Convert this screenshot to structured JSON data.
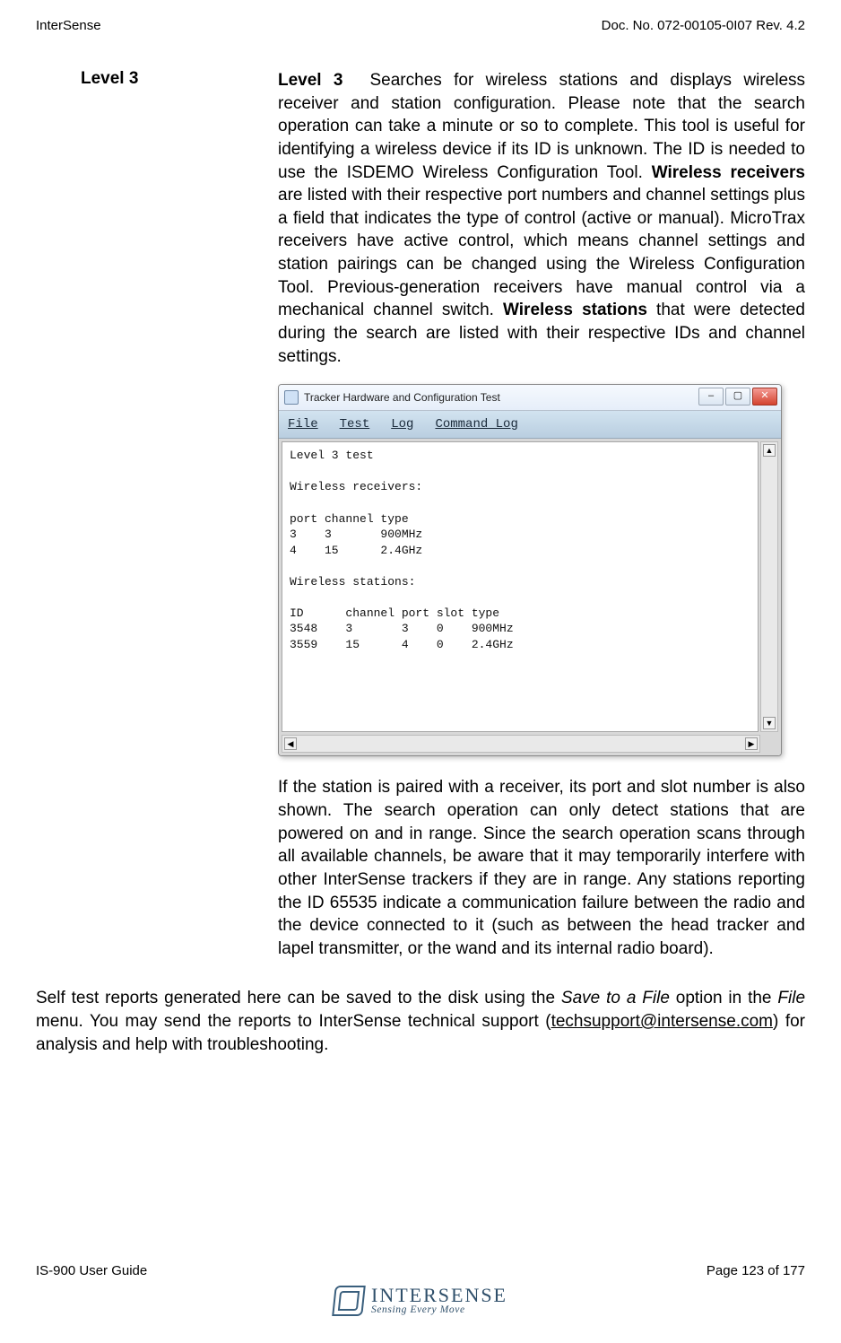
{
  "header": {
    "left": "InterSense",
    "right": "Doc. No. 072-00105-0I07 Rev. 4.2"
  },
  "section": {
    "label": "Level 3",
    "lead": "Level 3",
    "para1a": "Searches for wireless stations and displays wireless receiver  and  station configuration. Please  note  that the search operation can take a minute or so to complete. This tool is useful for identifying a wireless device if its ID is unknown. The ID is needed to use the ISDEMO Wireless Configuration Tool. ",
    "bold1": "Wireless receivers",
    "para1b": " are listed with their respective port numbers and channel settings plus a field that indicates the type of control (active or manual). MicroTrax receivers have active control, which means channel settings and station pairings can be changed using the Wireless Configuration Tool. Previous-generation receivers have manual control via a mechanical channel switch. ",
    "bold2": "Wireless stations",
    "para1c": " that were detected during the search are listed with their respective IDs and channel settings.",
    "para2": " If the station is paired with a receiver, its port and slot number is also shown. The search operation can only detect stations that are powered on and in range. Since the search operation scans through all available channels, be aware that it may temporarily interfere with other InterSense trackers if they are in range.  Any stations reporting the ID 65535 indicate a communication failure between the radio and the device connected to it (such as between the head tracker and lapel transmitter, or the wand and its internal radio board)."
  },
  "win": {
    "title": "Tracker Hardware and Configuration Test",
    "menu": {
      "file": "File",
      "test": "Test",
      "log": "Log",
      "cmdlog": "Command Log"
    },
    "ctrl": {
      "min": "–",
      "max": "▢",
      "close": "✕"
    },
    "body": "Level 3 test\n\nWireless receivers:\n\nport channel type\n3    3       900MHz\n4    15      2.4GHz\n\nWireless stations:\n\nID      channel port slot type\n3548    3       3    0    900MHz\n3559    15      4    0    2.4GHz",
    "scroll": {
      "up": "▲",
      "down": "▼",
      "left": "◀",
      "right": "▶"
    }
  },
  "bottom": {
    "t1": "Self test reports generated here can be saved to the disk using the ",
    "i1": "Save to a File",
    "t2": " option in the ",
    "i2": "File",
    "t3": " menu.  You may send the reports to InterSense technical support (",
    "link": "techsupport@intersense.com",
    "t4": ") for analysis and help with troubleshooting."
  },
  "footer": {
    "left": "IS-900 User Guide",
    "right": "Page 123 of 177",
    "logo_big": "INTERSENSE",
    "logo_small": "Sensing Every Move"
  }
}
